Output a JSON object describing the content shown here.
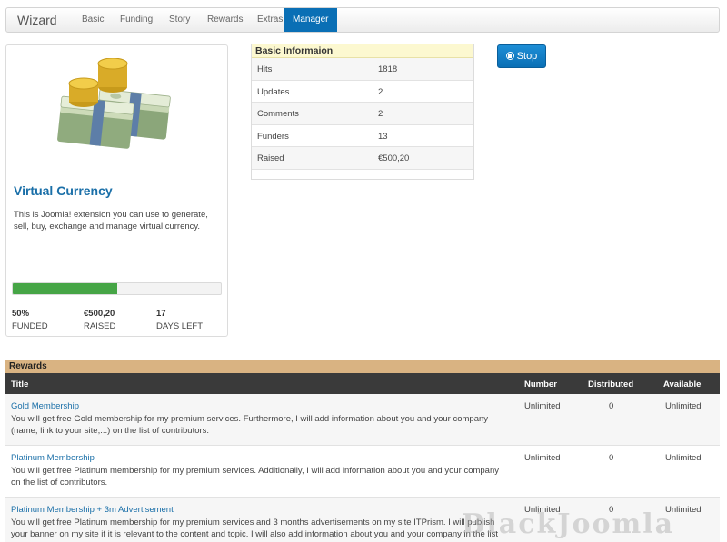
{
  "navbar": {
    "brand": "Wizard",
    "items": [
      {
        "label": "Basic",
        "active": false
      },
      {
        "label": "Funding",
        "active": false
      },
      {
        "label": "Story",
        "active": false
      },
      {
        "label": "Rewards",
        "active": false
      },
      {
        "label": "Extras",
        "active": false
      },
      {
        "label": "Manager",
        "active": true
      }
    ],
    "active_color": "#0a6fb5"
  },
  "project": {
    "image": "money-stack-image",
    "title": "Virtual Currency",
    "description": "This is Joomla! extension you can use to generate, sell, buy, exchange and manage virtual currency.",
    "progress_percent": 50,
    "stats": [
      {
        "value": "50%",
        "label": "FUNDED"
      },
      {
        "value": "€500,20",
        "label": "RAISED"
      },
      {
        "value": "17",
        "label": "DAYS LEFT"
      }
    ],
    "progress_color": "#46a546"
  },
  "basic_info": {
    "heading": "Basic Informaion",
    "rows": [
      {
        "key": "Hits",
        "value": "1818"
      },
      {
        "key": "Updates",
        "value": "2"
      },
      {
        "key": "Comments",
        "value": "2"
      },
      {
        "key": "Funders",
        "value": "13"
      },
      {
        "key": "Raised",
        "value": "€500,20"
      }
    ]
  },
  "actions": {
    "stop_label": "Stop",
    "stop_icon": "stop-circle-icon"
  },
  "rewards": {
    "heading": "Rewards",
    "columns": {
      "title": "Title",
      "number": "Number",
      "distributed": "Distributed",
      "available": "Available"
    },
    "rows": [
      {
        "title": "Gold Membership",
        "description": "You will get free Gold membership for my premium services. Furthermore, I will add information about you and your company (name, link to your site,...) on the list of contributors.",
        "number": "Unlimited",
        "distributed": "0",
        "available": "Unlimited"
      },
      {
        "title": "Platinum Membership",
        "description": "You will get free Platinum membership for my premium services. Additionally, I will add information about you and your company on the list of contributors.",
        "number": "Unlimited",
        "distributed": "0",
        "available": "Unlimited"
      },
      {
        "title": "Platinum Membership + 3m Advertisement",
        "description": "You will get free Platinum membership for my premium services and 3 months advertisements on my site ITPrism. I will publish your banner on my site if it is relevant to the content and topic. I will also add information about you and your company in the list of",
        "number": "Unlimited",
        "distributed": "0",
        "available": "Unlimited"
      }
    ],
    "header_color": "#d9b382"
  },
  "watermark": "BlackJoomla"
}
